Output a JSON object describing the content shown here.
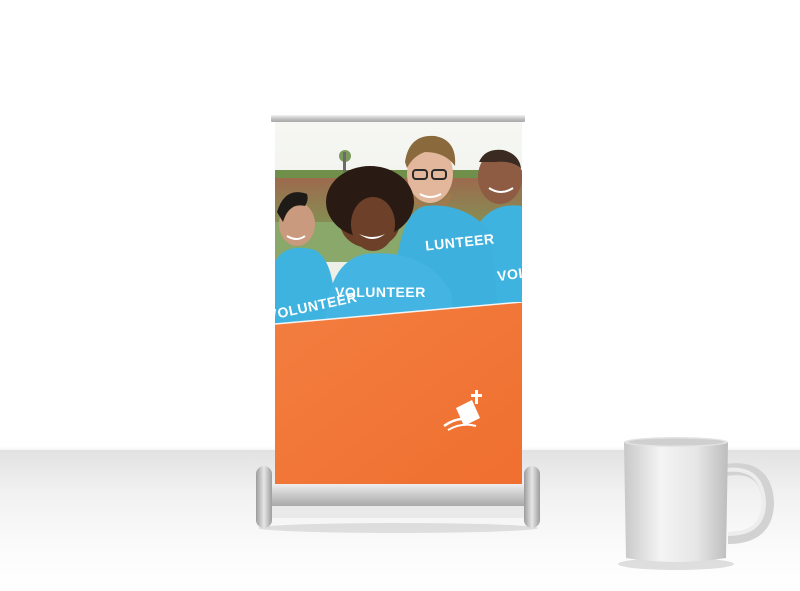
{
  "banner": {
    "shirt_text_1": "VOLUNTEER",
    "shirt_text_2": "VOLUNTEER",
    "shirt_text_3": "LUNTEER",
    "shirt_text_4": "VOLUNT",
    "accent_color": "#f2783a",
    "shirt_color": "#3fb3e0",
    "logo": "church-cross-icon"
  },
  "scene": {
    "objects": [
      "roll-up-banner-stand",
      "coffee-mug"
    ]
  }
}
